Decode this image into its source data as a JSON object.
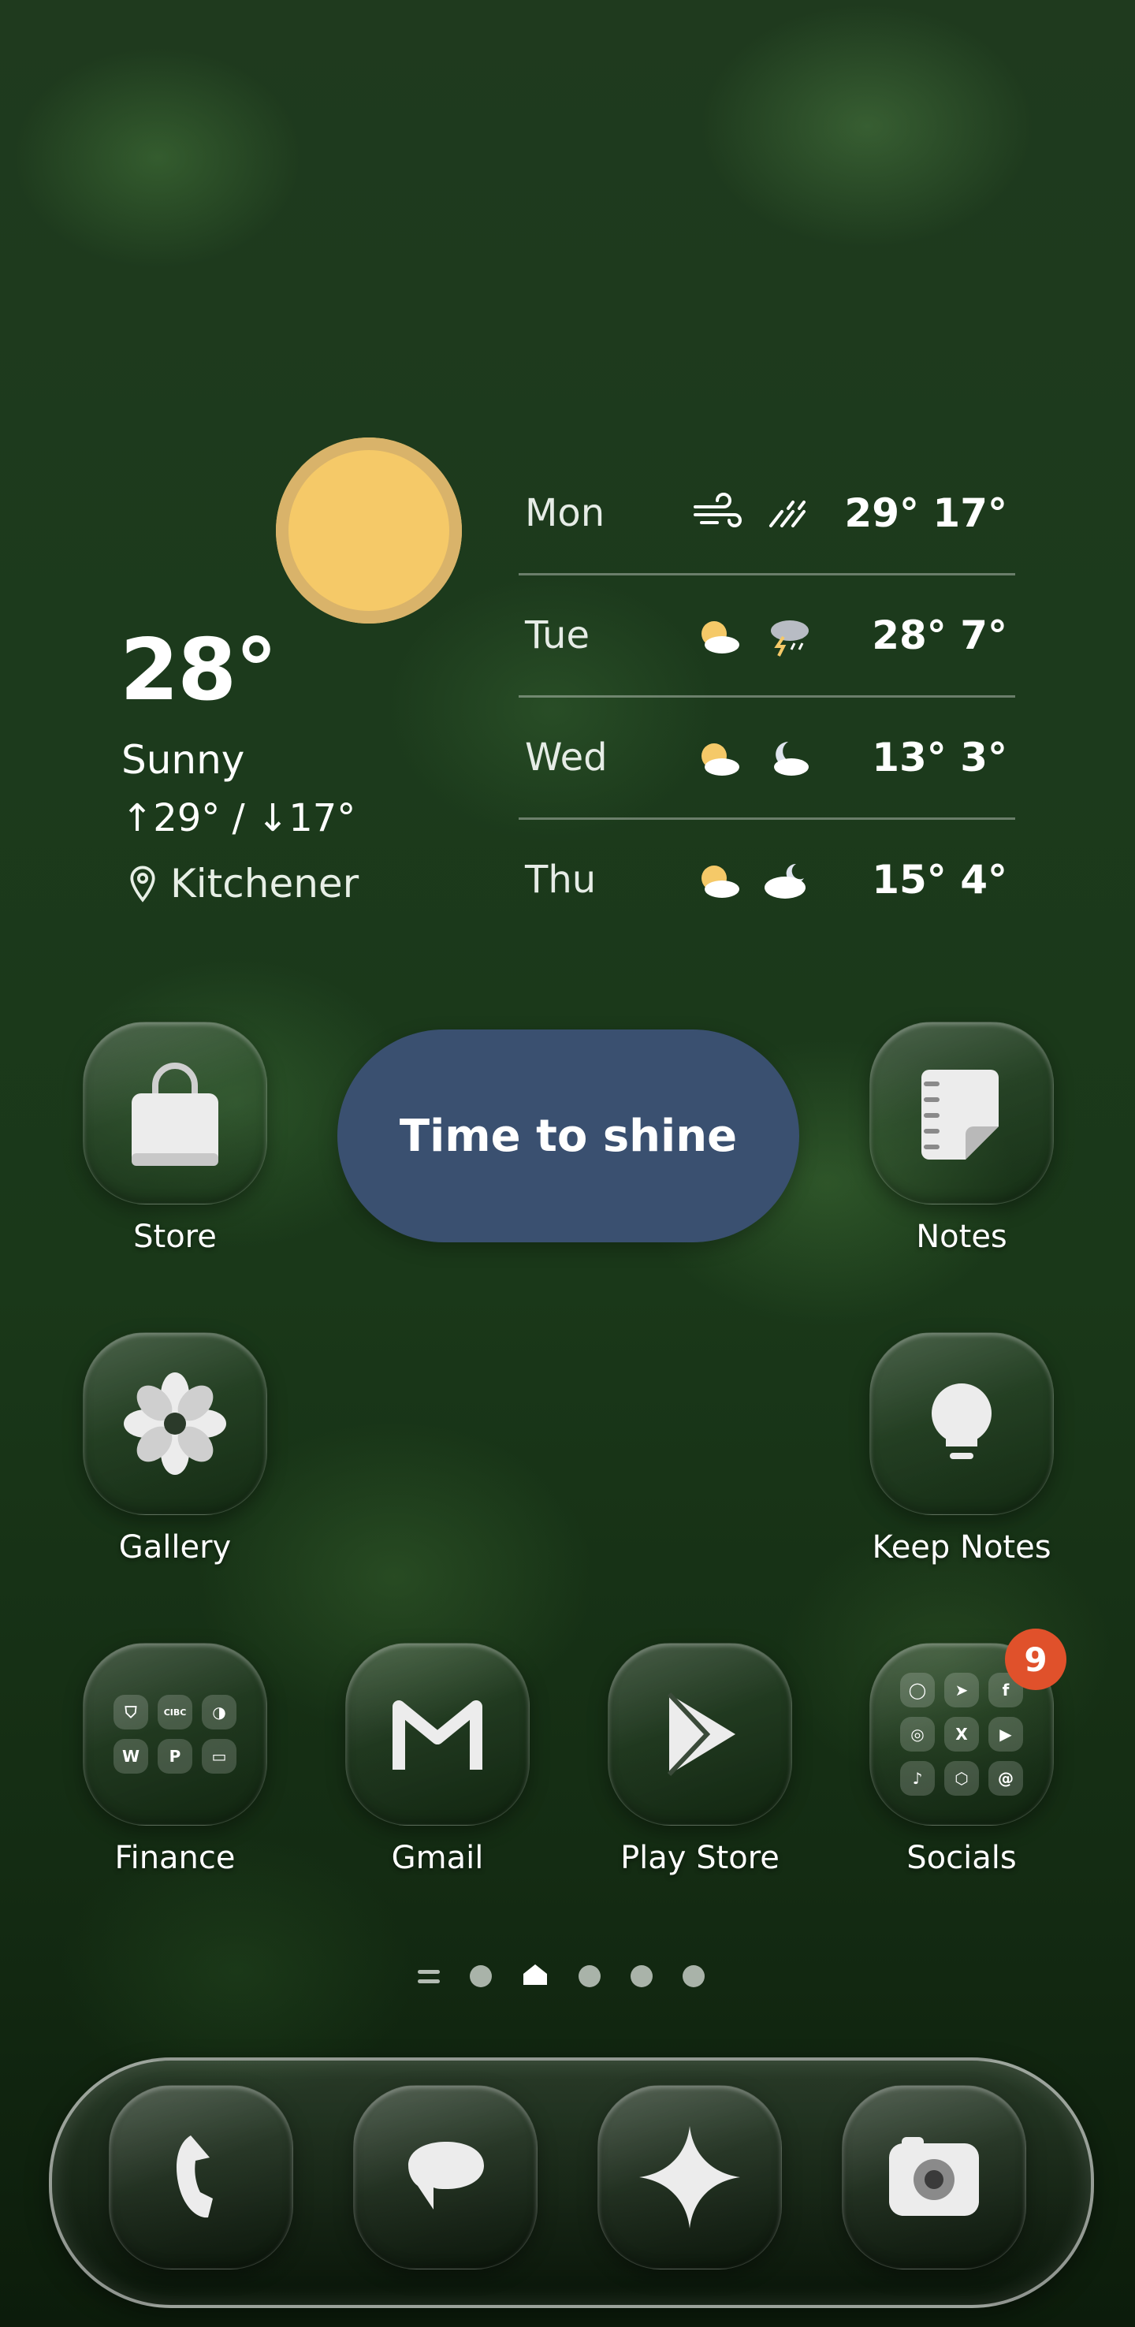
{
  "weather": {
    "current_temp": "28°",
    "condition": "Sunny",
    "high_low": "↑29° / ↓17°",
    "location": "Kitchener",
    "colors": {
      "sun": "#f5c968"
    },
    "forecast": [
      {
        "day": "Mon",
        "day_icon": "wind-icon",
        "night_icon": "rain-streaks-icon",
        "temps": "29° 17°"
      },
      {
        "day": "Tue",
        "day_icon": "partly-sunny-icon",
        "night_icon": "thunderstorm-icon",
        "temps": "28° 7°"
      },
      {
        "day": "Wed",
        "day_icon": "partly-sunny-icon",
        "night_icon": "moon-cloud-icon",
        "temps": "13° 3°"
      },
      {
        "day": "Thu",
        "day_icon": "partly-sunny-icon",
        "night_icon": "cloud-moon-icon",
        "temps": "15° 4°"
      }
    ]
  },
  "widget": {
    "label": "Time to shine",
    "color": "#3a5070"
  },
  "apps": {
    "store": "Store",
    "notes": "Notes",
    "gallery": "Gallery",
    "keep_notes": "Keep Notes",
    "finance": "Finance",
    "gmail": "Gmail",
    "play_store": "Play Store",
    "socials": "Socials"
  },
  "finance_folder": [
    "shield-icon",
    "CIBC",
    "raccoon-icon",
    "wealthsimple-icon",
    "paypal-icon",
    "card-icon"
  ],
  "socials_folder": [
    "whatsapp-icon",
    "telegram-icon",
    "facebook-icon",
    "instagram-icon",
    "x-icon",
    "youtube-icon",
    "tiktok-icon",
    "hex-icon",
    "threads-icon"
  ],
  "socials_badge": "9",
  "dock": [
    "phone-icon",
    "messages-icon",
    "gemini-icon",
    "camera-icon"
  ],
  "pager": {
    "pages": 6,
    "active": 2
  }
}
